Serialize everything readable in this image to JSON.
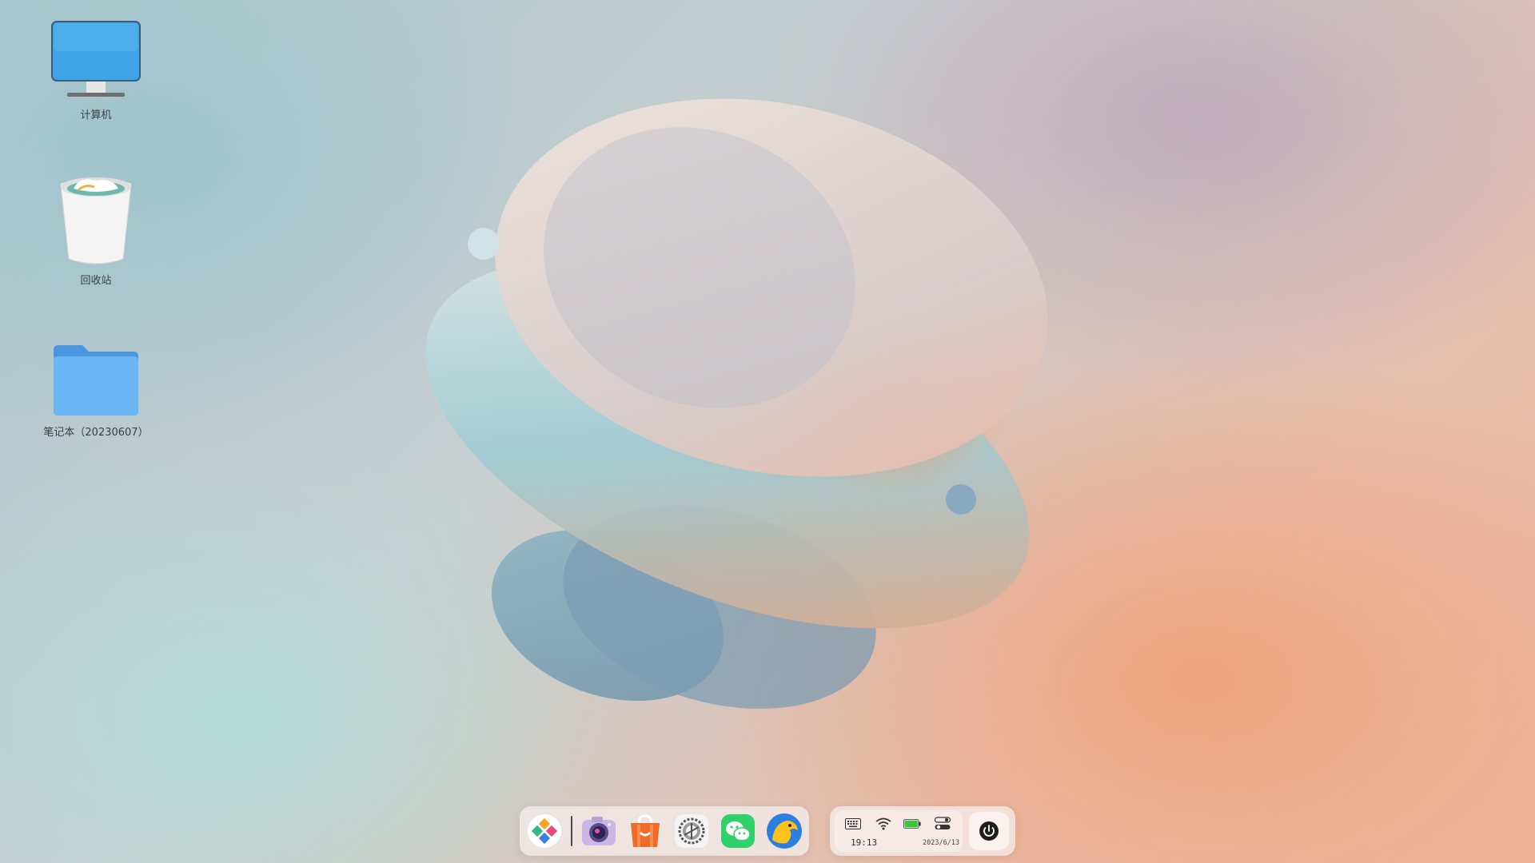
{
  "desktop": {
    "icons": [
      {
        "label": "计算机",
        "icon": "computer-monitor-icon"
      },
      {
        "label": "回收站",
        "icon": "trash-bin-icon"
      },
      {
        "label": "笔记本（20230607）",
        "icon": "folder-icon"
      }
    ]
  },
  "dock": {
    "apps": [
      {
        "icon": "launcher-icon"
      },
      {
        "icon": "camera-icon"
      },
      {
        "icon": "app-store-icon"
      },
      {
        "icon": "settings-gear-icon"
      },
      {
        "icon": "wechat-icon"
      },
      {
        "icon": "browser-icon"
      }
    ]
  },
  "tray": {
    "icons": [
      "keyboard-icon",
      "wifi-icon",
      "battery-icon",
      "toggles-icon"
    ],
    "time": "19:13",
    "date": "2023/6/13",
    "power_icon": "power-icon"
  },
  "colors": {
    "folder": "#5aa8ec",
    "monitor_screen": "#3ea4e6",
    "wechat": "#2fd16a",
    "store": "#f06a2a"
  }
}
